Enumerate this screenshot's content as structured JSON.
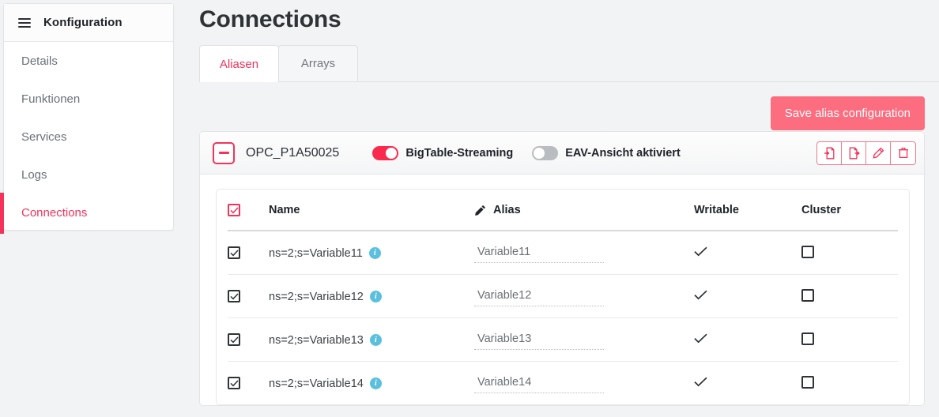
{
  "sidebar": {
    "menu_icon": "hamburger-icon",
    "title": "Konfiguration",
    "items": [
      {
        "label": "Details",
        "active": false
      },
      {
        "label": "Funktionen",
        "active": false
      },
      {
        "label": "Services",
        "active": false
      },
      {
        "label": "Logs",
        "active": false
      },
      {
        "label": "Connections",
        "active": true
      }
    ]
  },
  "main": {
    "page_title": "Connections",
    "tabs": [
      {
        "label": "Aliasen",
        "active": true
      },
      {
        "label": "Arrays",
        "active": false
      }
    ],
    "save_button": "Save alias configuration"
  },
  "card": {
    "collapse_icon": "minus-icon",
    "connection_name": "OPC_P1A50025",
    "toggles": [
      {
        "label": "BigTable-Streaming",
        "state": "on"
      },
      {
        "label": "EAV-Ansicht aktiviert",
        "state": "off"
      }
    ],
    "actions": [
      {
        "icon": "file-import-icon"
      },
      {
        "icon": "file-export-icon"
      },
      {
        "icon": "pencil-icon"
      },
      {
        "icon": "trash-icon"
      }
    ]
  },
  "table": {
    "header_checkbox_checked": true,
    "alias_header_icon": "pencil-icon",
    "columns": [
      "Name",
      "Alias",
      "Writable",
      "Cluster"
    ],
    "rows": [
      {
        "selected": true,
        "name": "ns=2;s=Variable11",
        "info_icon": "info-icon",
        "alias": "Variable11",
        "writable": true,
        "cluster": false
      },
      {
        "selected": true,
        "name": "ns=2;s=Variable12",
        "info_icon": "info-icon",
        "alias": "Variable12",
        "writable": true,
        "cluster": false
      },
      {
        "selected": true,
        "name": "ns=2;s=Variable13",
        "info_icon": "info-icon",
        "alias": "Variable13",
        "writable": true,
        "cluster": false
      },
      {
        "selected": true,
        "name": "ns=2;s=Variable14",
        "info_icon": "info-icon",
        "alias": "Variable14",
        "writable": true,
        "cluster": false
      }
    ]
  },
  "colors": {
    "accent": "#f4325a",
    "accent_soft": "#fb6d7f",
    "toggle_on": "#fa2a4e",
    "toggle_off": "#b9bcc0",
    "info": "#5bc0de",
    "page_bg": "#f2f3f5"
  }
}
